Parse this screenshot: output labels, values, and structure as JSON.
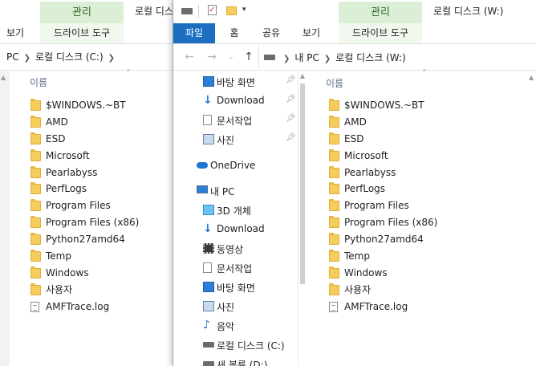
{
  "window_c": {
    "title_prefix": "로컬 디스",
    "manage_tab": "관리",
    "ribbon_tabs": [
      "보기",
      "드라이브 도구"
    ],
    "breadcrumb": [
      "PC",
      "로컬 디스크 (C:)"
    ],
    "column_name": "이름",
    "files": [
      {
        "name": "$WINDOWS.~BT",
        "type": "folder"
      },
      {
        "name": "AMD",
        "type": "folder"
      },
      {
        "name": "ESD",
        "type": "folder"
      },
      {
        "name": "Microsoft",
        "type": "folder"
      },
      {
        "name": "Pearlabyss",
        "type": "folder"
      },
      {
        "name": "PerfLogs",
        "type": "folder"
      },
      {
        "name": "Program Files",
        "type": "folder"
      },
      {
        "name": "Program Files (x86)",
        "type": "folder"
      },
      {
        "name": "Python27amd64",
        "type": "folder"
      },
      {
        "name": "Temp",
        "type": "folder"
      },
      {
        "name": "Windows",
        "type": "folder"
      },
      {
        "name": "사용자",
        "type": "folder"
      },
      {
        "name": "AMFTrace.log",
        "type": "file"
      }
    ]
  },
  "window_w": {
    "title": "로컬 디스크 (W:)",
    "manage_tab": "관리",
    "ribbon_tabs": {
      "file": "파일",
      "home": "홈",
      "share": "공유",
      "view": "보기",
      "drive_tools": "드라이브 도구"
    },
    "breadcrumb": [
      "내 PC",
      "로컬 디스크 (W:)"
    ],
    "column_name": "이름",
    "quick_access": [
      {
        "label": "바탕 화면",
        "icon": "desktop-icon",
        "pinned": true
      },
      {
        "label": "Download",
        "icon": "download-arrow-icon",
        "pinned": true
      },
      {
        "label": "문서작업",
        "icon": "document-icon",
        "pinned": true
      },
      {
        "label": "사진",
        "icon": "pictures-icon",
        "pinned": true
      }
    ],
    "onedrive": {
      "label": "OneDrive",
      "icon": "cloud-icon"
    },
    "this_pc": {
      "label": "내 PC",
      "icon": "computer-icon"
    },
    "pc_items": [
      {
        "label": "3D 개체",
        "icon": "cube-3d-icon"
      },
      {
        "label": "Download",
        "icon": "download-arrow-icon"
      },
      {
        "label": "동영상",
        "icon": "video-film-icon"
      },
      {
        "label": "문서작업",
        "icon": "document-icon"
      },
      {
        "label": "바탕 화면",
        "icon": "desktop-icon"
      },
      {
        "label": "사진",
        "icon": "pictures-icon"
      },
      {
        "label": "음악",
        "icon": "music-note-icon"
      },
      {
        "label": "로컬 디스크 (C:)",
        "icon": "drive-icon"
      },
      {
        "label": "새 볼륨 (D:)",
        "icon": "drive-icon"
      }
    ],
    "files": [
      {
        "name": "$WINDOWS.~BT",
        "type": "folder"
      },
      {
        "name": "AMD",
        "type": "folder"
      },
      {
        "name": "ESD",
        "type": "folder"
      },
      {
        "name": "Microsoft",
        "type": "folder"
      },
      {
        "name": "Pearlabyss",
        "type": "folder"
      },
      {
        "name": "PerfLogs",
        "type": "folder"
      },
      {
        "name": "Program Files",
        "type": "folder"
      },
      {
        "name": "Program Files (x86)",
        "type": "folder"
      },
      {
        "name": "Python27amd64",
        "type": "folder"
      },
      {
        "name": "Temp",
        "type": "folder"
      },
      {
        "name": "Windows",
        "type": "folder"
      },
      {
        "name": "사용자",
        "type": "folder"
      },
      {
        "name": "AMFTrace.log",
        "type": "file"
      }
    ]
  },
  "colors": {
    "file_tab": "#1c6ec1",
    "manage_tab_bg": "#dbefd6",
    "folder": "#f6cd5b"
  }
}
